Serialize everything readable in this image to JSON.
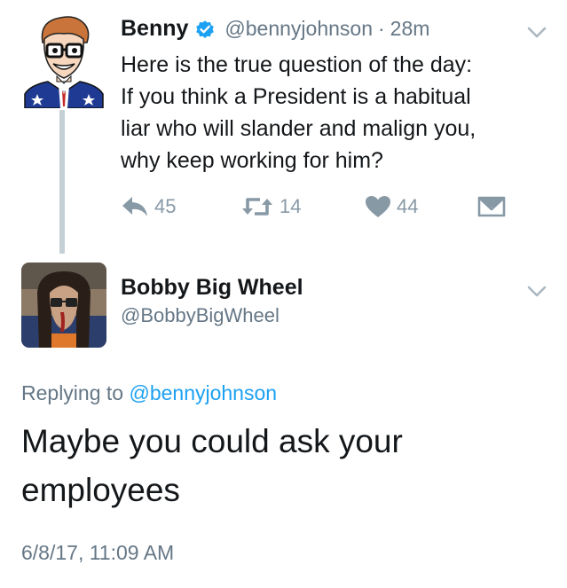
{
  "colors": {
    "accent": "#1da1f2",
    "text_primary": "#14171a",
    "text_secondary": "#657786",
    "action_icon": "#8899a6",
    "thread_line": "#c4cfd6"
  },
  "tweet1": {
    "author_name": "Benny",
    "verified": true,
    "handle": "@bennyjohnson",
    "separator": "·",
    "time": "28m",
    "text_lines": [
      "Here is the true question of the day:",
      "If you think a President is a habitual",
      "liar who will slander and malign you,",
      "why keep working for him?"
    ],
    "actions": {
      "reply": {
        "icon": "reply-icon",
        "count": "45"
      },
      "retweet": {
        "icon": "retweet-icon",
        "count": "14"
      },
      "like": {
        "icon": "heart-icon",
        "count": "44"
      },
      "message": {
        "icon": "envelope-icon"
      }
    }
  },
  "tweet2": {
    "author_name": "Bobby Big Wheel",
    "handle": "@BobbyBigWheel",
    "replying_prefix": "Replying to",
    "replying_to": "@bennyjohnson",
    "text_lines": [
      "Maybe you could ask your",
      "employees"
    ],
    "timestamp": "6/8/17, 11:09 AM"
  }
}
